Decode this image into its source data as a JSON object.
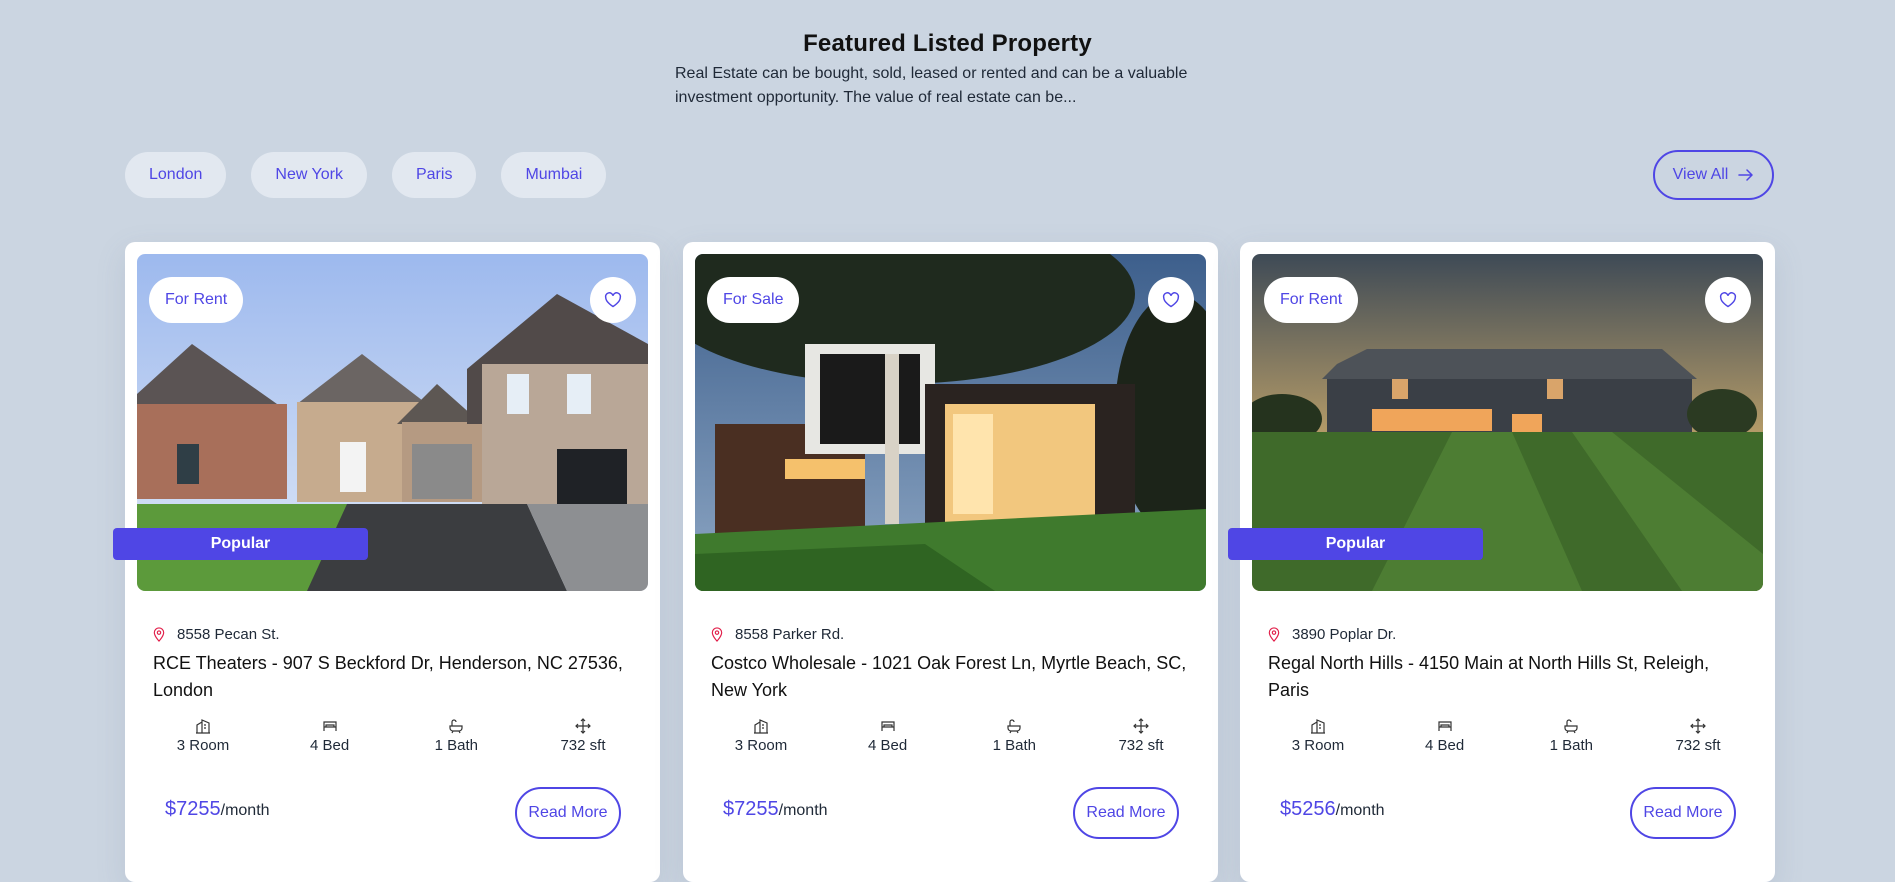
{
  "section": {
    "title": "Featured Listed Property",
    "subtitle": "Real Estate can be bought, sold, leased or rented and can be a valuable investment opportunity. The value of real estate can be..."
  },
  "filters": [
    "London",
    "New York",
    "Paris",
    "Mumbai"
  ],
  "view_all_label": "View All",
  "icons": {
    "arrow": "arrow-right-icon",
    "heart": "heart-icon",
    "pin": "map-pin-icon",
    "room": "building-icon",
    "bed": "bed-icon",
    "bath": "bathtub-icon",
    "area": "move-arrows-icon"
  },
  "colors": {
    "accent": "#4f46e5",
    "background": "#cbd5e1",
    "chip": "#e2e8f0",
    "pin": "#e11d48"
  },
  "listings": [
    {
      "status": "For Rent",
      "badge": "Popular",
      "address": "8558 Pecan St.",
      "name": "RCE Theaters - 907 S Beckford Dr, Henderson, NC 27536, London",
      "rooms": "3 Room",
      "beds": "4 Bed",
      "baths": "1 Bath",
      "area": "732 sft",
      "price": "$7255",
      "period": "/month",
      "read_more": "Read More"
    },
    {
      "status": "For Sale",
      "badge": "",
      "address": "8558 Parker Rd.",
      "name": "Costco Wholesale - 1021 Oak Forest Ln, Myrtle Beach, SC, New York",
      "rooms": "3 Room",
      "beds": "4 Bed",
      "baths": "1 Bath",
      "area": "732 sft",
      "price": "$7255",
      "period": "/month",
      "read_more": "Read More"
    },
    {
      "status": "For Rent",
      "badge": "Popular",
      "address": "3890 Poplar Dr.",
      "name": "Regal North Hills - 4150 Main at North Hills St, Releigh, Paris",
      "rooms": "3 Room",
      "beds": "4 Bed",
      "baths": "1 Bath",
      "area": "732 sft",
      "price": "$5256",
      "period": "/month",
      "read_more": "Read More"
    }
  ]
}
